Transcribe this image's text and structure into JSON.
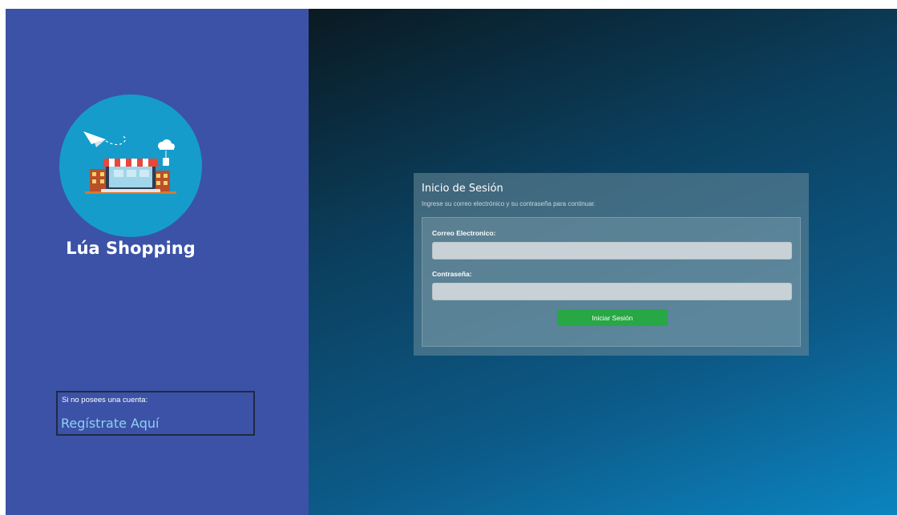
{
  "brand": {
    "name": "Lúa Shopping",
    "logo_icon": "storefront-logo-icon"
  },
  "register": {
    "prompt": "Si no posees una cuenta:",
    "link_label": "Regístrate Aquí"
  },
  "login": {
    "title": "Inicio de Sesión",
    "subtitle": "Ingrese su correo electrónico y su contraseña para continuar.",
    "email_label": "Correo Electronico:",
    "email_value": "",
    "password_label": "Contraseña:",
    "password_value": "",
    "submit_label": "Iniciar Sesión"
  },
  "colors": {
    "sidebar": "#3c52a6",
    "logo_circle": "#169ccb",
    "submit": "#28a745",
    "link": "#8fd0f2"
  }
}
